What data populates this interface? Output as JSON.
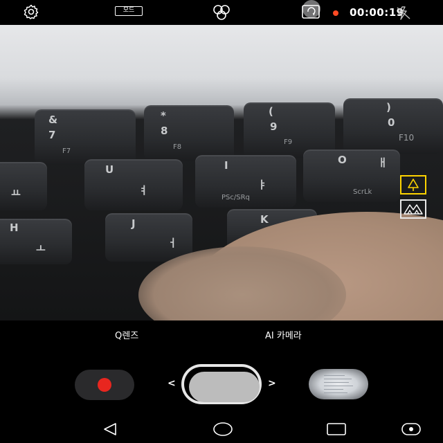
{
  "topbar": {
    "mode_label": "모드",
    "timer": "00:00:19",
    "icons": [
      "settings-icon",
      "filter-icon",
      "switch-camera-icon",
      "flash-off-icon"
    ],
    "recording_dot_color": "#ff4a24"
  },
  "viewfinder": {
    "keys": {
      "k7_symbol": "&",
      "k7_num": "7",
      "k7_fn": "F7",
      "k8_symbol": "*",
      "k8_num": "8",
      "k8_fn": "F8",
      "k9_symbol": "(",
      "k9_num": "9",
      "k9_fn": "F9",
      "k0_symbol": ")",
      "k0_num": "0",
      "k0_fn": "F10",
      "ku_letter": "U",
      "ku_hangul": "ㅕ",
      "ki_letter": "I",
      "ki_hangul": "ㅑ",
      "ki_sub": "PSc/SRq",
      "ko_letter": "O",
      "ko_hangul": "ㅐ",
      "ko_sub": "ScrLk",
      "ky_hangul": "ㅛ",
      "kh_letter": "H",
      "kh_hangul": "ㅗ",
      "kj_letter": "J",
      "kj_hangul": "ㅓ",
      "kk_letter": "K"
    },
    "scene_modes": [
      "tree-scene-icon",
      "landscape-scene-icon"
    ],
    "scene_active_color": "#ffd400"
  },
  "lens": {
    "q_lens": "Q렌즈",
    "ai_camera": "AI 카메라"
  },
  "controls": {
    "record_color": "#e8261f",
    "prev_chevron": "<",
    "next_chevron": ">"
  },
  "nav": {
    "icons": [
      "back-icon",
      "home-icon",
      "recents-icon",
      "assistant-icon"
    ]
  }
}
